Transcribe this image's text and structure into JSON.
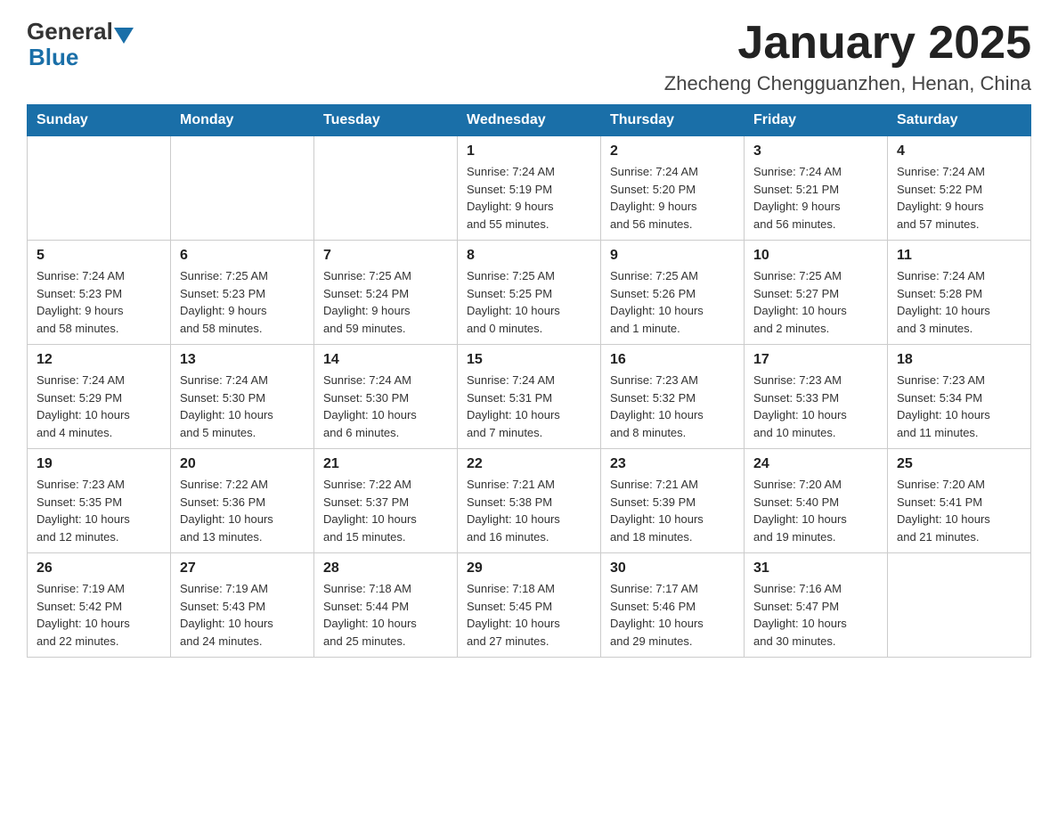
{
  "header": {
    "logo_general": "General",
    "logo_blue": "Blue",
    "month_title": "January 2025",
    "location": "Zhecheng Chengguanzhen, Henan, China"
  },
  "weekdays": [
    "Sunday",
    "Monday",
    "Tuesday",
    "Wednesday",
    "Thursday",
    "Friday",
    "Saturday"
  ],
  "weeks": [
    [
      {
        "day": "",
        "info": ""
      },
      {
        "day": "",
        "info": ""
      },
      {
        "day": "",
        "info": ""
      },
      {
        "day": "1",
        "info": "Sunrise: 7:24 AM\nSunset: 5:19 PM\nDaylight: 9 hours\nand 55 minutes."
      },
      {
        "day": "2",
        "info": "Sunrise: 7:24 AM\nSunset: 5:20 PM\nDaylight: 9 hours\nand 56 minutes."
      },
      {
        "day": "3",
        "info": "Sunrise: 7:24 AM\nSunset: 5:21 PM\nDaylight: 9 hours\nand 56 minutes."
      },
      {
        "day": "4",
        "info": "Sunrise: 7:24 AM\nSunset: 5:22 PM\nDaylight: 9 hours\nand 57 minutes."
      }
    ],
    [
      {
        "day": "5",
        "info": "Sunrise: 7:24 AM\nSunset: 5:23 PM\nDaylight: 9 hours\nand 58 minutes."
      },
      {
        "day": "6",
        "info": "Sunrise: 7:25 AM\nSunset: 5:23 PM\nDaylight: 9 hours\nand 58 minutes."
      },
      {
        "day": "7",
        "info": "Sunrise: 7:25 AM\nSunset: 5:24 PM\nDaylight: 9 hours\nand 59 minutes."
      },
      {
        "day": "8",
        "info": "Sunrise: 7:25 AM\nSunset: 5:25 PM\nDaylight: 10 hours\nand 0 minutes."
      },
      {
        "day": "9",
        "info": "Sunrise: 7:25 AM\nSunset: 5:26 PM\nDaylight: 10 hours\nand 1 minute."
      },
      {
        "day": "10",
        "info": "Sunrise: 7:25 AM\nSunset: 5:27 PM\nDaylight: 10 hours\nand 2 minutes."
      },
      {
        "day": "11",
        "info": "Sunrise: 7:24 AM\nSunset: 5:28 PM\nDaylight: 10 hours\nand 3 minutes."
      }
    ],
    [
      {
        "day": "12",
        "info": "Sunrise: 7:24 AM\nSunset: 5:29 PM\nDaylight: 10 hours\nand 4 minutes."
      },
      {
        "day": "13",
        "info": "Sunrise: 7:24 AM\nSunset: 5:30 PM\nDaylight: 10 hours\nand 5 minutes."
      },
      {
        "day": "14",
        "info": "Sunrise: 7:24 AM\nSunset: 5:30 PM\nDaylight: 10 hours\nand 6 minutes."
      },
      {
        "day": "15",
        "info": "Sunrise: 7:24 AM\nSunset: 5:31 PM\nDaylight: 10 hours\nand 7 minutes."
      },
      {
        "day": "16",
        "info": "Sunrise: 7:23 AM\nSunset: 5:32 PM\nDaylight: 10 hours\nand 8 minutes."
      },
      {
        "day": "17",
        "info": "Sunrise: 7:23 AM\nSunset: 5:33 PM\nDaylight: 10 hours\nand 10 minutes."
      },
      {
        "day": "18",
        "info": "Sunrise: 7:23 AM\nSunset: 5:34 PM\nDaylight: 10 hours\nand 11 minutes."
      }
    ],
    [
      {
        "day": "19",
        "info": "Sunrise: 7:23 AM\nSunset: 5:35 PM\nDaylight: 10 hours\nand 12 minutes."
      },
      {
        "day": "20",
        "info": "Sunrise: 7:22 AM\nSunset: 5:36 PM\nDaylight: 10 hours\nand 13 minutes."
      },
      {
        "day": "21",
        "info": "Sunrise: 7:22 AM\nSunset: 5:37 PM\nDaylight: 10 hours\nand 15 minutes."
      },
      {
        "day": "22",
        "info": "Sunrise: 7:21 AM\nSunset: 5:38 PM\nDaylight: 10 hours\nand 16 minutes."
      },
      {
        "day": "23",
        "info": "Sunrise: 7:21 AM\nSunset: 5:39 PM\nDaylight: 10 hours\nand 18 minutes."
      },
      {
        "day": "24",
        "info": "Sunrise: 7:20 AM\nSunset: 5:40 PM\nDaylight: 10 hours\nand 19 minutes."
      },
      {
        "day": "25",
        "info": "Sunrise: 7:20 AM\nSunset: 5:41 PM\nDaylight: 10 hours\nand 21 minutes."
      }
    ],
    [
      {
        "day": "26",
        "info": "Sunrise: 7:19 AM\nSunset: 5:42 PM\nDaylight: 10 hours\nand 22 minutes."
      },
      {
        "day": "27",
        "info": "Sunrise: 7:19 AM\nSunset: 5:43 PM\nDaylight: 10 hours\nand 24 minutes."
      },
      {
        "day": "28",
        "info": "Sunrise: 7:18 AM\nSunset: 5:44 PM\nDaylight: 10 hours\nand 25 minutes."
      },
      {
        "day": "29",
        "info": "Sunrise: 7:18 AM\nSunset: 5:45 PM\nDaylight: 10 hours\nand 27 minutes."
      },
      {
        "day": "30",
        "info": "Sunrise: 7:17 AM\nSunset: 5:46 PM\nDaylight: 10 hours\nand 29 minutes."
      },
      {
        "day": "31",
        "info": "Sunrise: 7:16 AM\nSunset: 5:47 PM\nDaylight: 10 hours\nand 30 minutes."
      },
      {
        "day": "",
        "info": ""
      }
    ]
  ]
}
